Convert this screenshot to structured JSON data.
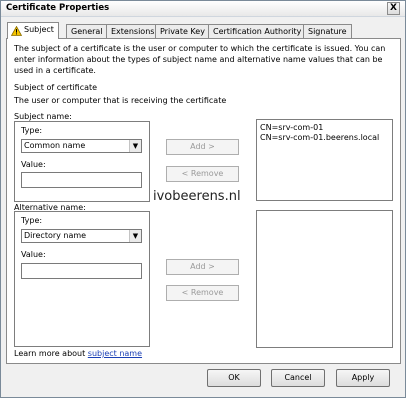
{
  "window": {
    "title": "Certificate Properties",
    "close_glyph": "X"
  },
  "tabs": [
    {
      "label": "Subject",
      "active": true
    },
    {
      "label": "General"
    },
    {
      "label": "Extensions"
    },
    {
      "label": "Private Key"
    },
    {
      "label": "Certification Authority"
    },
    {
      "label": "Signature"
    }
  ],
  "subject_tab": {
    "description": "The subject of a certificate is the user or computer to which the certificate is issued. You can enter information about the types of subject name and alternative name values that can be used in a certificate.",
    "subject_heading": "Subject of certificate",
    "subject_subheading": "The user or computer that is receiving the certificate",
    "subject_name": {
      "group_label": "Subject name:",
      "type_label": "Type:",
      "type_value": "Common name",
      "value_label": "Value:",
      "value": "",
      "add_label": "Add >",
      "remove_label": "< Remove",
      "list_items": [
        "CN=srv-com-01",
        "CN=srv-com-01.beerens.local"
      ]
    },
    "alternative_name": {
      "group_label": "Alternative name:",
      "type_label": "Type:",
      "type_value": "Directory name",
      "value_label": "Value:",
      "value": "",
      "add_label": "Add >",
      "remove_label": "< Remove",
      "list_items": []
    },
    "learn_more_prefix": "Learn more about",
    "learn_more_link": "subject name"
  },
  "watermark": "ivobeerens.nl",
  "buttons": {
    "ok": "OK",
    "cancel": "Cancel",
    "apply": "Apply"
  },
  "icons": {
    "tab_warning": "warning-icon",
    "combo_arrow": "chevron-down-icon"
  },
  "colors": {
    "link": "#1a3fb5",
    "disabled_text": "#9a9a9a"
  }
}
